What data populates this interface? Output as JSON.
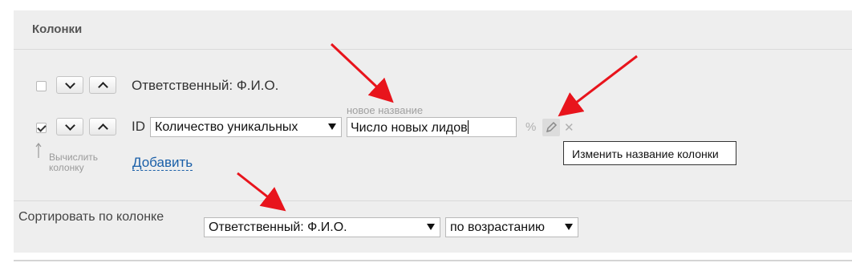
{
  "panel": {
    "title": "Колонки"
  },
  "columns": [
    {
      "checked": false,
      "label": "Ответственный: Ф.И.О."
    },
    {
      "checked": true,
      "id_label": "ID",
      "select_value": "Количество уникальных",
      "rename_hint": "новое название",
      "rename_value": "Число новых лидов",
      "percent_icon": "%",
      "edit_icon": "pencil-icon",
      "remove_icon": "✕"
    }
  ],
  "calc": {
    "line1": "Вычислить",
    "line2": "колонку"
  },
  "add_link": "Добавить",
  "tooltip": "Изменить название колонки",
  "sort": {
    "label": "Сортировать по колонке",
    "column_value": "Ответственный: Ф.И.О.",
    "order_value": "по возрастанию"
  },
  "colors": {
    "annotation_arrow": "#e8141c",
    "link": "#1a5fa8",
    "panel_bg": "#eeeeee"
  }
}
